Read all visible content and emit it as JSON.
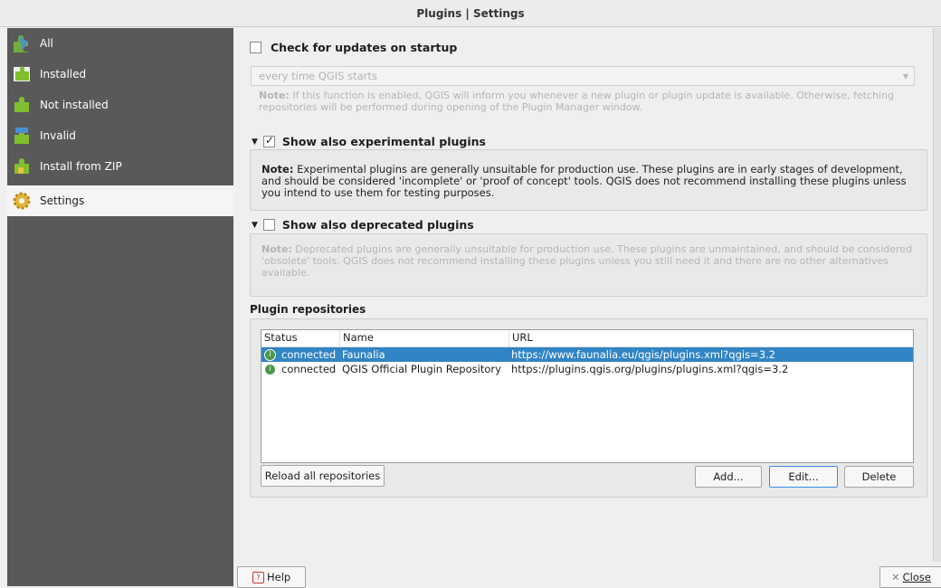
{
  "window": {
    "title": "Plugins | Settings"
  },
  "sidebar": {
    "items": [
      {
        "label": "All",
        "icon": "puzzle-all-icon"
      },
      {
        "label": "Installed",
        "icon": "puzzle-installed-icon"
      },
      {
        "label": "Not installed",
        "icon": "puzzle-not-installed-icon"
      },
      {
        "label": "Invalid",
        "icon": "puzzle-invalid-icon"
      },
      {
        "label": "Install from ZIP",
        "icon": "puzzle-zip-icon"
      },
      {
        "label": "Settings",
        "icon": "gear-icon",
        "active": true
      }
    ]
  },
  "updates": {
    "checkbox_label": "Check for updates on startup",
    "checked": false,
    "frequency_value": "every time QGIS starts",
    "note_bold": "Note:",
    "note_text": " If this function is enabled, QGIS will inform you whenever a new plugin or plugin update is available. Otherwise, fetching repositories will be performed during opening of the Plugin Manager window."
  },
  "experimental": {
    "checkbox_label": "Show also experimental plugins",
    "checked": true,
    "note_bold": "Note:",
    "note_text": " Experimental plugins are generally unsuitable for production use. These plugins are in early stages of development, and should be considered 'incomplete' or 'proof of concept' tools. QGIS does not recommend installing these plugins unless you intend to use them for testing purposes."
  },
  "deprecated": {
    "checkbox_label": "Show also deprecated plugins",
    "checked": false,
    "note_bold": "Note:",
    "note_text": " Deprecated plugins are generally unsuitable for production use. These plugins are unmaintained, and should be considered 'obsolete' tools. QGIS does not recommend installing these plugins unless you still need it and there are no other alternatives available."
  },
  "repositories": {
    "title": "Plugin repositories",
    "columns": [
      "Status",
      "Name",
      "URL"
    ],
    "rows": [
      {
        "status": "connected",
        "name": "Faunalia",
        "url": "https://www.faunalia.eu/qgis/plugins.xml?qgis=3.2",
        "selected": true
      },
      {
        "status": "connected",
        "name": "QGIS Official Plugin Repository",
        "url": "https://plugins.qgis.org/plugins/plugins.xml?qgis=3.2",
        "selected": false
      }
    ],
    "reload_label": "Reload all repositories",
    "add_label": "Add...",
    "edit_label": "Edit...",
    "delete_label": "Delete"
  },
  "footer": {
    "help_label": "Help",
    "close_label": "Close"
  },
  "colors": {
    "sidebar_bg": "#595959",
    "selection": "#3185c4",
    "status_ok": "#4a9a4a"
  }
}
